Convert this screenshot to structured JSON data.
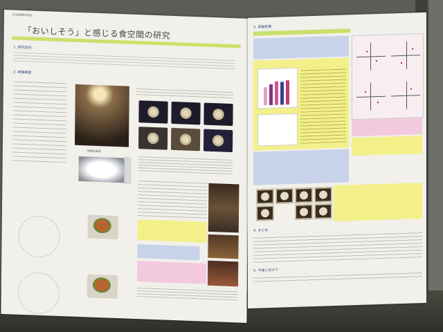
{
  "poster_left": {
    "header_small": "日本調理科学会",
    "title": "「おいしそう」と感じる食空間の研究",
    "sections": {
      "purpose": "1. 研究目的",
      "overview": "2. 実験概要",
      "results": "3. 実験結果",
      "conclusion": "4. まとめ",
      "future": "5. 今後に向けて"
    },
    "captions": {
      "room": "実験室風景",
      "light": "照明器具"
    }
  },
  "colors": {
    "accent_green": "#c9e06a",
    "blue_box": "#c8d3ea",
    "yellow_box": "#f3f08a",
    "pink_box": "#f3c9dd"
  }
}
